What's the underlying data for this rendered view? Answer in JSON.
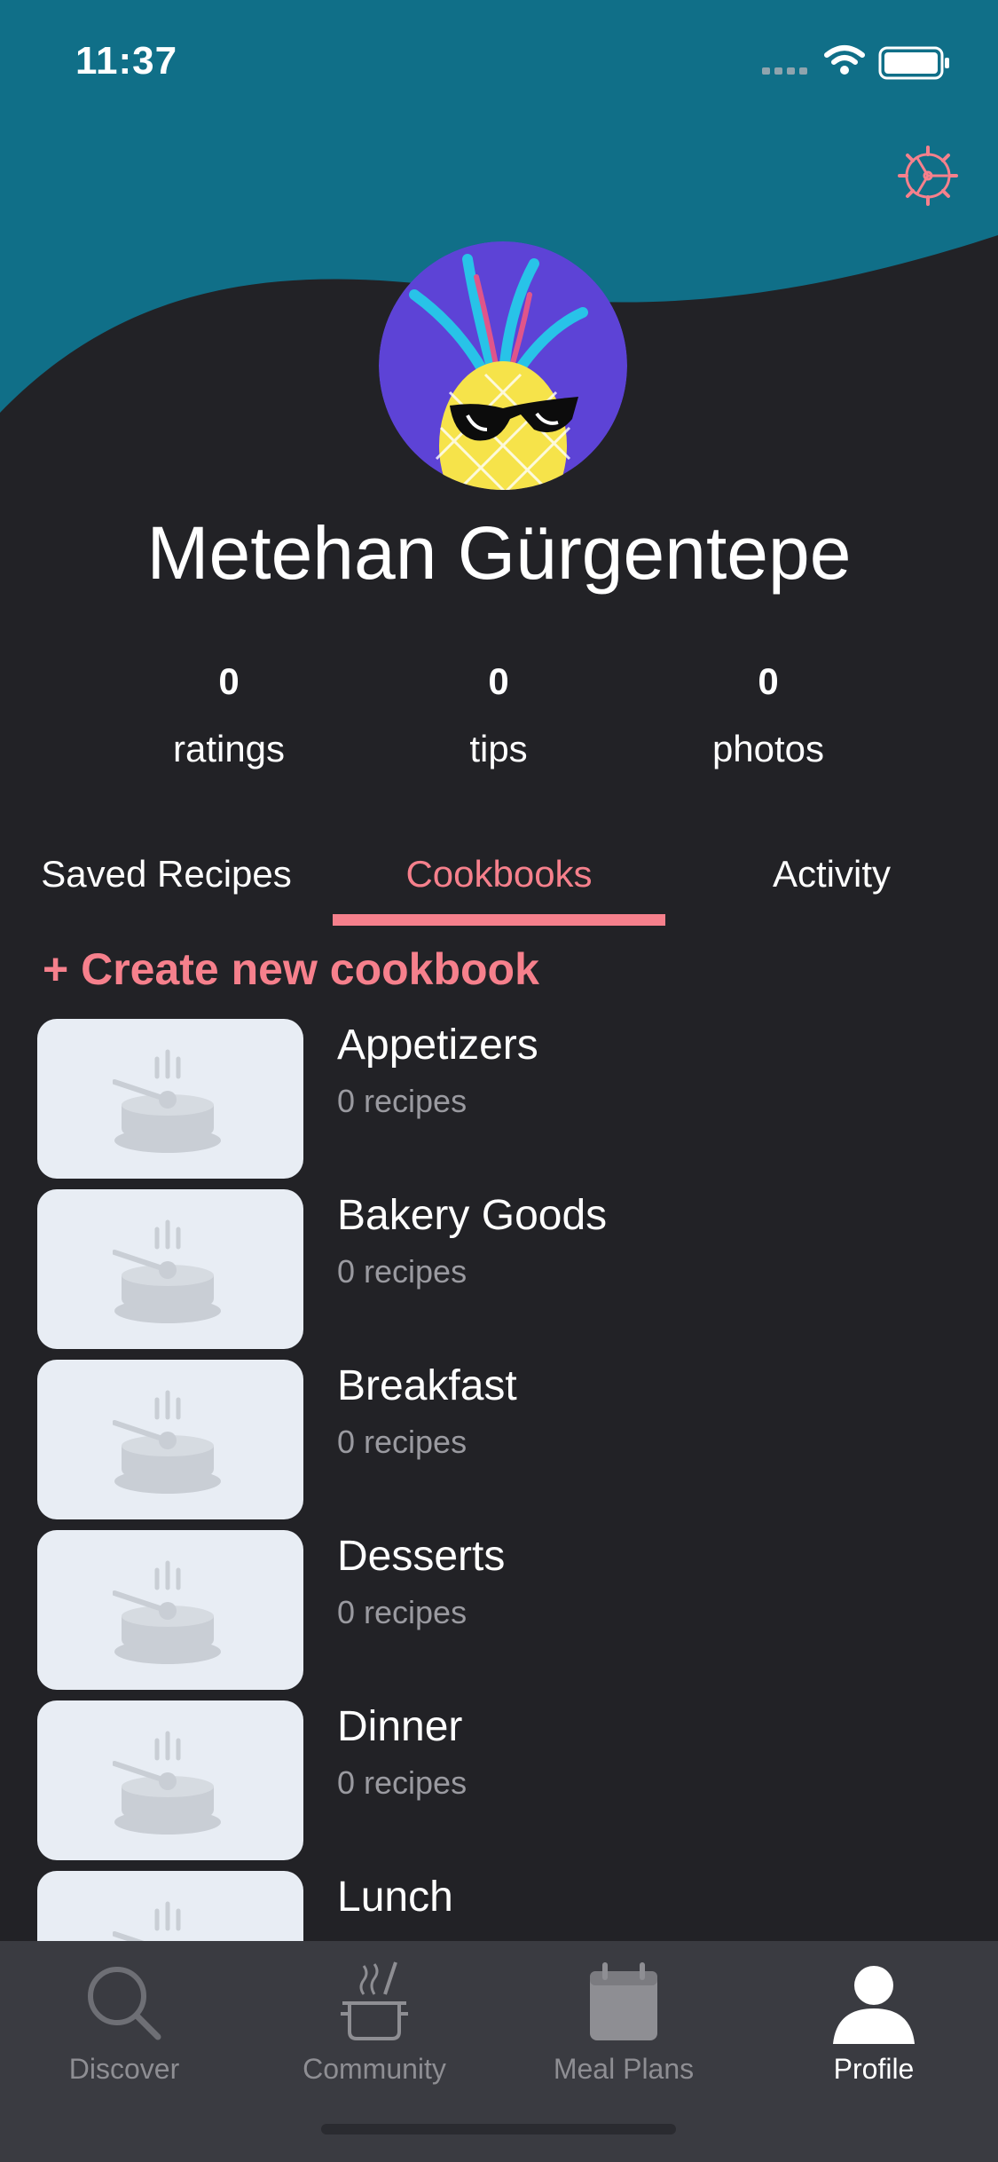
{
  "status_bar": {
    "time": "11:37"
  },
  "profile": {
    "name": "Metehan Gürgentepe"
  },
  "stats": [
    {
      "value": "0",
      "label": "ratings"
    },
    {
      "value": "0",
      "label": "tips"
    },
    {
      "value": "0",
      "label": "photos"
    }
  ],
  "tabs": [
    {
      "label": "Saved Recipes",
      "active": false
    },
    {
      "label": "Cookbooks",
      "active": true
    },
    {
      "label": "Activity",
      "active": false
    }
  ],
  "create_cookbook_label": "+ Create new cookbook",
  "cookbooks": [
    {
      "title": "Appetizers",
      "count": "0 recipes"
    },
    {
      "title": "Bakery Goods",
      "count": "0 recipes"
    },
    {
      "title": "Breakfast",
      "count": "0 recipes"
    },
    {
      "title": "Desserts",
      "count": "0 recipes"
    },
    {
      "title": "Dinner",
      "count": "0 recipes"
    },
    {
      "title": "Lunch",
      "count": ""
    }
  ],
  "tab_bar": [
    {
      "label": "Discover",
      "icon": "search-icon",
      "active": false
    },
    {
      "label": "Community",
      "icon": "pot-icon",
      "active": false
    },
    {
      "label": "Meal Plans",
      "icon": "calendar-icon",
      "active": false
    },
    {
      "label": "Profile",
      "icon": "person-icon",
      "active": true
    }
  ],
  "colors": {
    "header": "#106f88",
    "accent": "#f6808c",
    "background": "#222226",
    "tab_bar": "#3a3b41"
  }
}
